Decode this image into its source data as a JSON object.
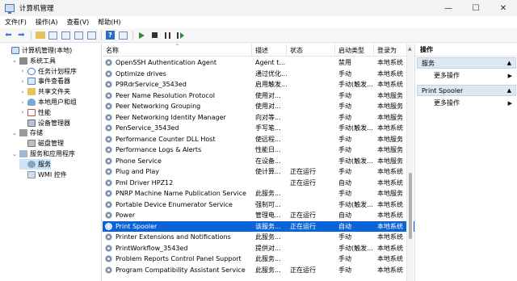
{
  "window": {
    "title": "计算机管理",
    "controls": [
      "—",
      "☐",
      "✕"
    ]
  },
  "menu": [
    "文件(F)",
    "操作(A)",
    "查看(V)",
    "帮助(H)"
  ],
  "tree": [
    {
      "label": "计算机管理(本地)",
      "level": 0,
      "expander": "",
      "icon": "computer-icon",
      "icls": "ti-pc"
    },
    {
      "label": "系统工具",
      "level": 1,
      "expander": "⌄",
      "icon": "tools-icon",
      "icls": "ti-tools"
    },
    {
      "label": "任务计划程序",
      "level": 2,
      "expander": "›",
      "icon": "clock-icon",
      "icls": "ti-clock"
    },
    {
      "label": "事件查看器",
      "level": 2,
      "expander": "›",
      "icon": "event-log-icon",
      "icls": "ti-log"
    },
    {
      "label": "共享文件夹",
      "level": 2,
      "expander": "›",
      "icon": "shared-folder-icon",
      "icls": "ti-folder"
    },
    {
      "label": "本地用户和组",
      "level": 2,
      "expander": "›",
      "icon": "users-icon",
      "icls": "ti-users"
    },
    {
      "label": "性能",
      "level": 2,
      "expander": "›",
      "icon": "performance-icon",
      "icls": "ti-perf"
    },
    {
      "label": "设备管理器",
      "level": 2,
      "expander": "",
      "icon": "device-manager-icon",
      "icls": "ti-dev"
    },
    {
      "label": "存储",
      "level": 1,
      "expander": "⌄",
      "icon": "storage-icon",
      "icls": "ti-storage"
    },
    {
      "label": "磁盘管理",
      "level": 2,
      "expander": "",
      "icon": "disk-icon",
      "icls": "ti-disk"
    },
    {
      "label": "服务和应用程序",
      "level": 1,
      "expander": "⌄",
      "icon": "services-apps-icon",
      "icls": "ti-svcapp"
    },
    {
      "label": "服务",
      "level": 2,
      "expander": "",
      "icon": "gear-icon",
      "icls": "ti-gear",
      "selected": true
    },
    {
      "label": "WMI 控件",
      "level": 2,
      "expander": "",
      "icon": "wmi-icon",
      "icls": "ti-wmi"
    }
  ],
  "list": {
    "columns": [
      "名称",
      "描述",
      "状态",
      "启动类型",
      "登录为"
    ],
    "rows": [
      [
        "OpenSSH Authentication Agent",
        "Agent t...",
        "",
        "禁用",
        "本地系统"
      ],
      [
        "Optimize drives",
        "通过优化...",
        "",
        "手动",
        "本地系统"
      ],
      [
        "P9RdrService_3543ed",
        "启用触发...",
        "",
        "手动(触发...",
        "本地系统"
      ],
      [
        "Peer Name Resolution Protocol",
        "使用对...",
        "",
        "手动",
        "本地服务"
      ],
      [
        "Peer Networking Grouping",
        "使用对...",
        "",
        "手动",
        "本地服务"
      ],
      [
        "Peer Networking Identity Manager",
        "向对等...",
        "",
        "手动",
        "本地服务"
      ],
      [
        "PenService_3543ed",
        "手写笔...",
        "",
        "手动(触发...",
        "本地系统"
      ],
      [
        "Performance Counter DLL Host",
        "使远程...",
        "",
        "手动",
        "本地服务"
      ],
      [
        "Performance Logs & Alerts",
        "性能日...",
        "",
        "手动",
        "本地服务"
      ],
      [
        "Phone Service",
        "在设备...",
        "",
        "手动(触发...",
        "本地服务"
      ],
      [
        "Plug and Play",
        "使计算...",
        "正在运行",
        "手动",
        "本地系统"
      ],
      [
        "PmI Driver HPZ12",
        "",
        "正在运行",
        "自动",
        "本地系统"
      ],
      [
        "PNRP Machine Name Publication Service",
        "此服务...",
        "",
        "手动",
        "本地服务"
      ],
      [
        "Portable Device Enumerator Service",
        "强制可...",
        "",
        "手动(触发...",
        "本地系统"
      ],
      [
        "Power",
        "管理电...",
        "正在运行",
        "自动",
        "本地系统"
      ],
      [
        "Print Spooler",
        "该服务...",
        "正在运行",
        "自动",
        "本地系统"
      ],
      [
        "Printer Extensions and Notifications",
        "此服务...",
        "",
        "手动",
        "本地系统"
      ],
      [
        "PrintWorkflow_3543ed",
        "提供对...",
        "",
        "手动(触发...",
        "本地系统"
      ],
      [
        "Problem Reports Control Panel Support",
        "此服务...",
        "",
        "手动",
        "本地系统"
      ],
      [
        "Program Compatibility Assistant Service",
        "此服务...",
        "正在运行",
        "手动",
        "本地系统"
      ]
    ],
    "selected_index": 15
  },
  "actions": {
    "title": "操作",
    "sections": [
      {
        "label": "服务",
        "item": "更多操作"
      },
      {
        "label": "Print Spooler",
        "item": "更多操作"
      }
    ]
  }
}
